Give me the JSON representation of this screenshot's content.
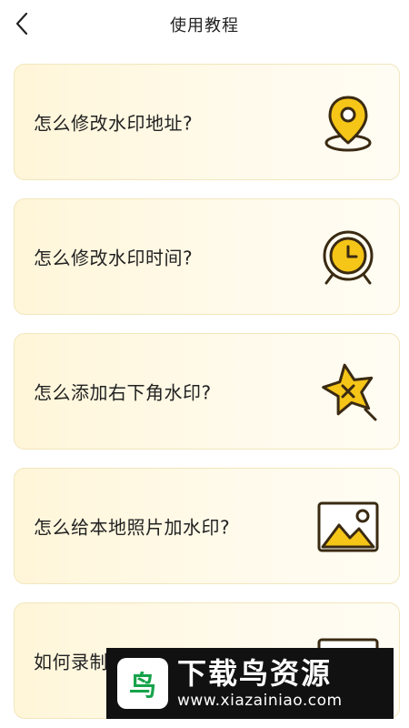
{
  "header": {
    "title": "使用教程",
    "back_icon": "chevron-left-icon"
  },
  "colors": {
    "accent_yellow": "#F5C518",
    "icon_stroke": "#3A2A12",
    "card_bg": "#FFF6D9",
    "card_border": "#F1E6BD"
  },
  "tutorials": [
    {
      "label": "怎么修改水印地址?",
      "icon": "location-pin-icon"
    },
    {
      "label": "怎么修改水印时间?",
      "icon": "alarm-clock-icon"
    },
    {
      "label": "怎么添加右下角水印?",
      "icon": "star-x-icon"
    },
    {
      "label": "怎么给本地照片加水印?",
      "icon": "image-icon"
    },
    {
      "label": "如何录制",
      "icon": "video-icon"
    }
  ],
  "watermark": {
    "logo_glyph": "鸟",
    "title": "下载鸟资源",
    "url": "www.xiazainiao.com"
  }
}
